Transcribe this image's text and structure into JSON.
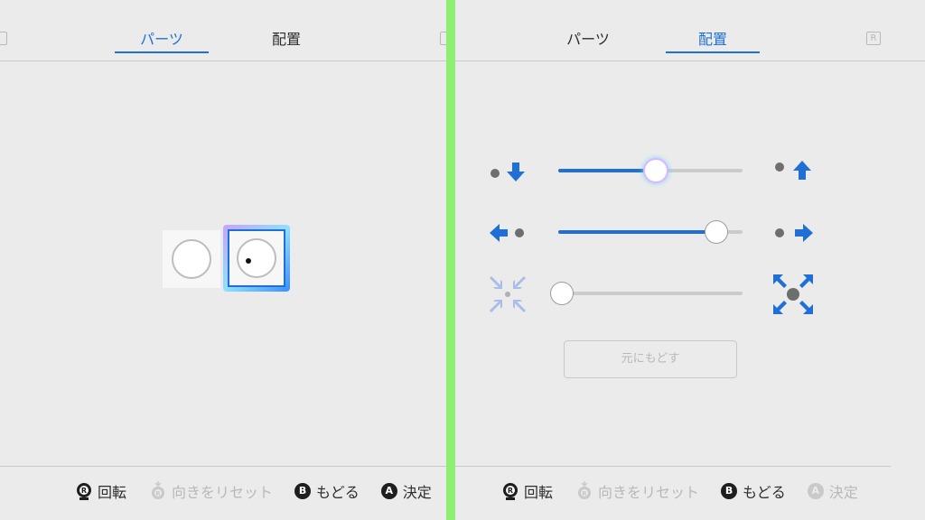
{
  "left": {
    "tabs": [
      {
        "label": "パーツ",
        "active": true
      },
      {
        "label": "配置",
        "active": false
      }
    ],
    "parts": [
      {
        "name": "circle"
      },
      {
        "name": "circle-with-dot",
        "selected": true
      }
    ],
    "footer": [
      {
        "button": "R",
        "label": "回転",
        "enabled": true,
        "icon": "right-stick-icon"
      },
      {
        "button": "R",
        "label": "向きをリセット",
        "enabled": false,
        "icon": "right-stick-press-icon"
      },
      {
        "button": "B",
        "label": "もどる",
        "enabled": true
      },
      {
        "button": "A",
        "label": "決定",
        "enabled": true
      }
    ]
  },
  "right": {
    "tabs": [
      {
        "label": "パーツ",
        "active": false
      },
      {
        "label": "配置",
        "active": true
      }
    ],
    "r_badge": "R",
    "sliders": [
      {
        "name": "vertical-position",
        "value": 0.53,
        "left_icon": "move-down-icon",
        "right_icon": "move-up-icon",
        "focused": true
      },
      {
        "name": "horizontal-position",
        "value": 0.86,
        "left_icon": "move-left-icon",
        "right_icon": "move-right-icon"
      },
      {
        "name": "size",
        "value": 0.02,
        "left_icon": "shrink-icon",
        "right_icon": "enlarge-icon"
      }
    ],
    "reset_label": "元にもどす",
    "footer": [
      {
        "button": "R",
        "label": "回転",
        "enabled": true,
        "icon": "right-stick-icon"
      },
      {
        "button": "R",
        "label": "向きをリセット",
        "enabled": false,
        "icon": "right-stick-press-icon"
      },
      {
        "button": "B",
        "label": "もどる",
        "enabled": true
      },
      {
        "button": "A",
        "label": "決定",
        "enabled": false
      }
    ]
  },
  "colors": {
    "accent": "#1f6fd6",
    "background": "#ebebeb",
    "divider": "#8fef73",
    "disabled": "#b8b8b8"
  }
}
